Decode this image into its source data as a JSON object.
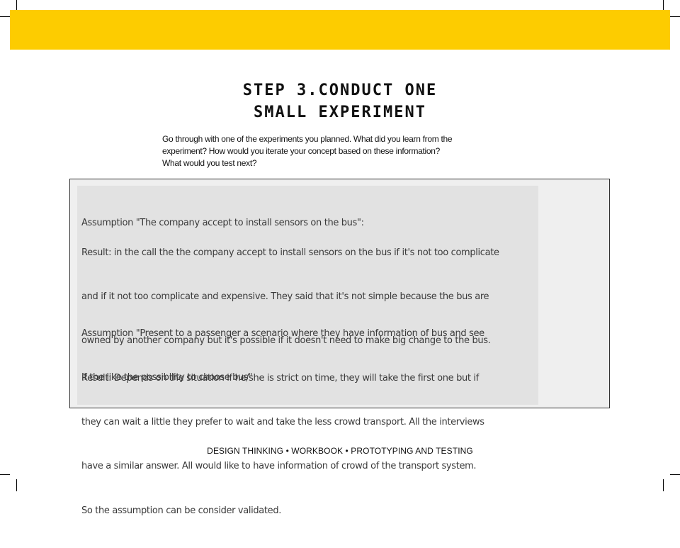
{
  "colors": {
    "banner": "#fdcc00",
    "panel": "#efefef",
    "content_box": "#e2e2e2"
  },
  "title": {
    "line1": "STEP 3.CONDUCT ONE",
    "line2": "SMALL EXPERIMENT"
  },
  "instructions": {
    "line1": "Go through with one of the experiments you planned. What did you learn from the",
    "line2": "experiment? How would you iterate your concept based on these information?",
    "line3": "What would you test next?"
  },
  "content": {
    "assumption1": "Assumption \"The company accept to install sensors on the bus\":",
    "result1_lines": [
      "Result: in the call the the company accept to install sensors on the bus if it's not too complicate",
      "and if it not too complicate and expensive. They said that it's not simple because the bus are",
      "owned by another company but it's possible if it doesn't need to make big change to the bus."
    ],
    "assumption2_lines": [
      "Assumption \"Present to a passenger a scenario where they have information of bus and see",
      "if the like the possibility to choose bus\""
    ],
    "result2_lines": [
      "Result: Depends on the situation if he/she is strict on time, they will take the first one but if",
      "they can wait a little they prefer to wait and take the less crowd transport. All the interviews",
      "have a similar answer. All would like to have information of crowd of the transport system.",
      "So the assumption can be consider validated."
    ]
  },
  "footer": "DESIGN THINKING  •  WORKBOOK  •  PROTOTYPING AND TESTING"
}
